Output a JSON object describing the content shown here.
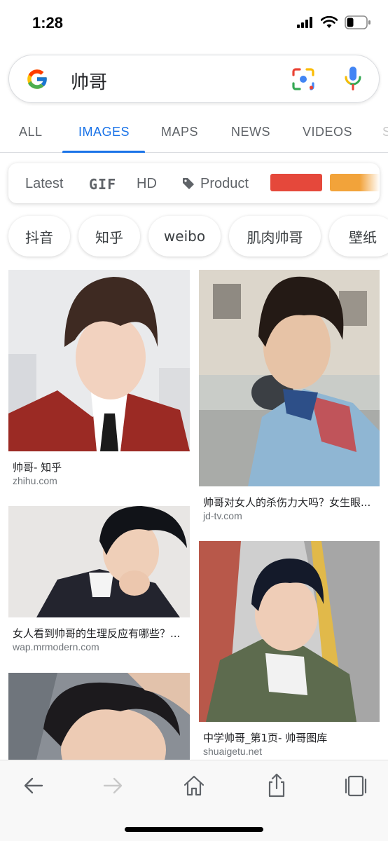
{
  "status": {
    "time": "1:28"
  },
  "search": {
    "query": "帅哥"
  },
  "tabs": [
    {
      "label": "ALL",
      "active": false
    },
    {
      "label": "IMAGES",
      "active": true
    },
    {
      "label": "MAPS",
      "active": false
    },
    {
      "label": "NEWS",
      "active": false
    },
    {
      "label": "VIDEOS",
      "active": false
    }
  ],
  "filters": {
    "latest": "Latest",
    "gif": "GIF",
    "hd": "HD",
    "product": "Product",
    "swatch_colors": [
      "#e5483b",
      "#f2a33a"
    ]
  },
  "chips": [
    "抖音",
    "知乎",
    "weibo",
    "肌肉帅哥",
    "壁纸"
  ],
  "results": [
    {
      "title": "帅哥- 知乎",
      "source": "zhihu.com"
    },
    {
      "title": "帅哥对女人的杀伤力大吗？女生眼...",
      "source": "jd-tv.com"
    },
    {
      "title": "女人看到帅哥的生理反应有哪些？...",
      "source": "wap.mrmodern.com"
    },
    {
      "title": "中学帅哥_第1页- 帅哥图库",
      "source": "shuaigetu.net"
    }
  ],
  "colors": {
    "accent": "#1a73e8",
    "tab_inactive": "#5f6368",
    "source_text": "#70757a"
  }
}
